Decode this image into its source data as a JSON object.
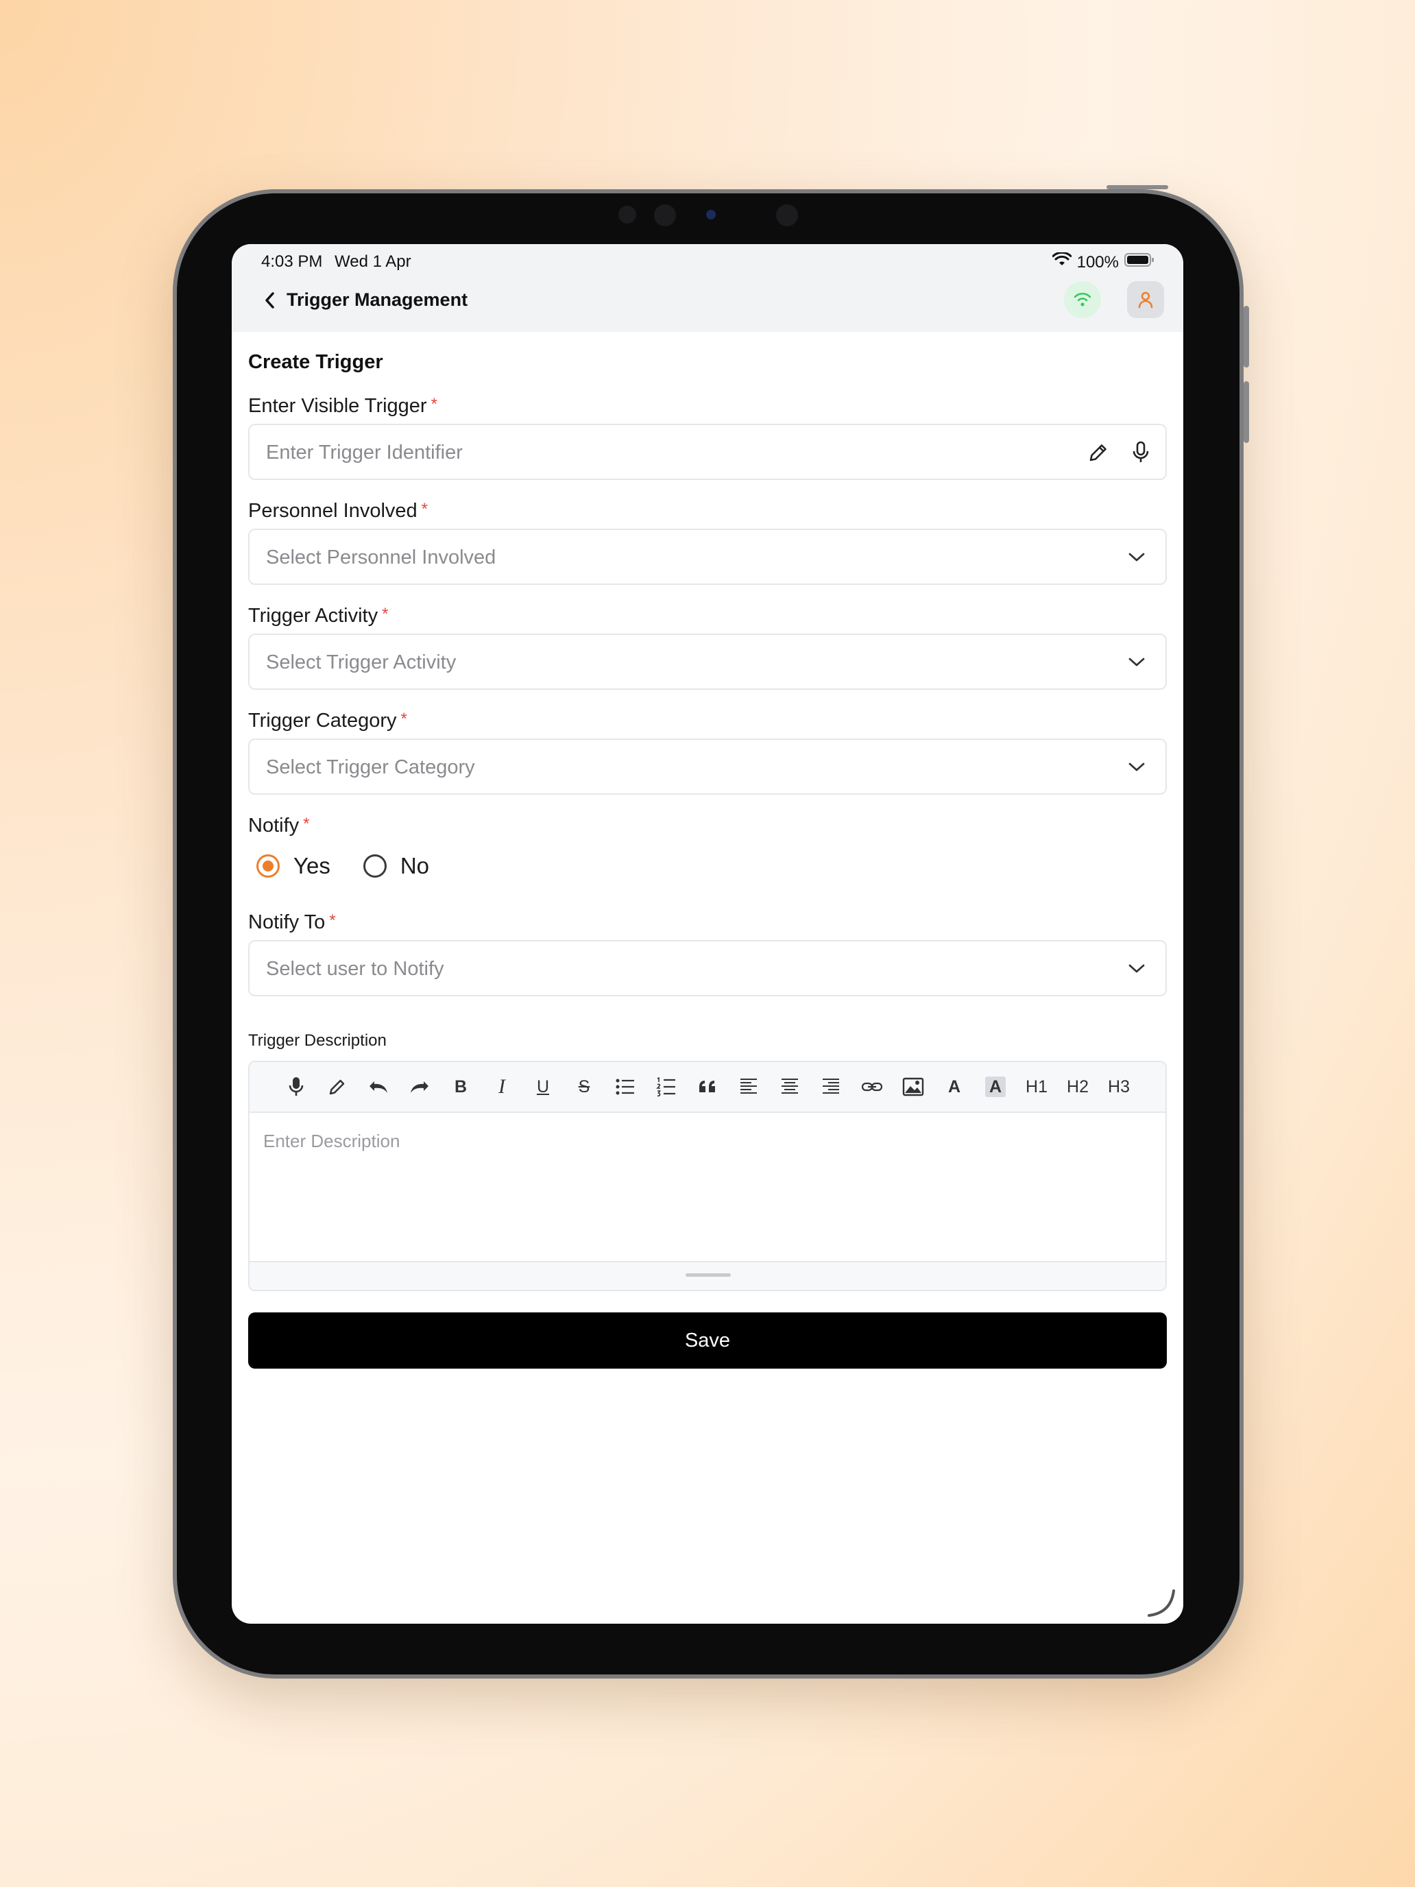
{
  "status_bar": {
    "time": "4:03 PM",
    "date": "Wed 1 Apr",
    "battery": "100%"
  },
  "nav": {
    "title": "Trigger Management"
  },
  "form": {
    "title": "Create Trigger",
    "visible_trigger": {
      "label": "Enter Visible Trigger",
      "required": "*",
      "placeholder": "Enter Trigger Identifier"
    },
    "personnel": {
      "label": "Personnel Involved",
      "required": "*",
      "placeholder": "Select Personnel Involved"
    },
    "activity": {
      "label": "Trigger Activity",
      "required": "*",
      "placeholder": "Select Trigger Activity"
    },
    "category": {
      "label": "Trigger Category",
      "required": "*",
      "placeholder": "Select Trigger Category"
    },
    "notify": {
      "label": "Notify",
      "required": "*",
      "options": [
        "Yes",
        "No"
      ],
      "selected": "Yes"
    },
    "notify_to": {
      "label": "Notify To",
      "required": "*",
      "placeholder": "Select user to Notify"
    },
    "description": {
      "label": "Trigger Description",
      "placeholder": "Enter Description",
      "toolbar": [
        "mic",
        "pencil",
        "undo",
        "redo",
        "bold",
        "italic",
        "underline",
        "strikethrough",
        "bullet-list",
        "numbered-list",
        "quote",
        "align-left",
        "align-center",
        "align-right",
        "link",
        "image",
        "font-color",
        "highlight",
        "H1",
        "H2",
        "H3"
      ],
      "toolbar_text": {
        "bold": "B",
        "italic": "I",
        "underline": "U",
        "strike": "S",
        "font_color": "A",
        "highlight": "A",
        "h1": "H1",
        "h2": "H2",
        "h3": "H3"
      }
    },
    "save_label": "Save"
  },
  "colors": {
    "accent": "#ee7d2a",
    "required": "#e5483d",
    "button_bg": "#000000",
    "wifi_green": "#34c759"
  }
}
